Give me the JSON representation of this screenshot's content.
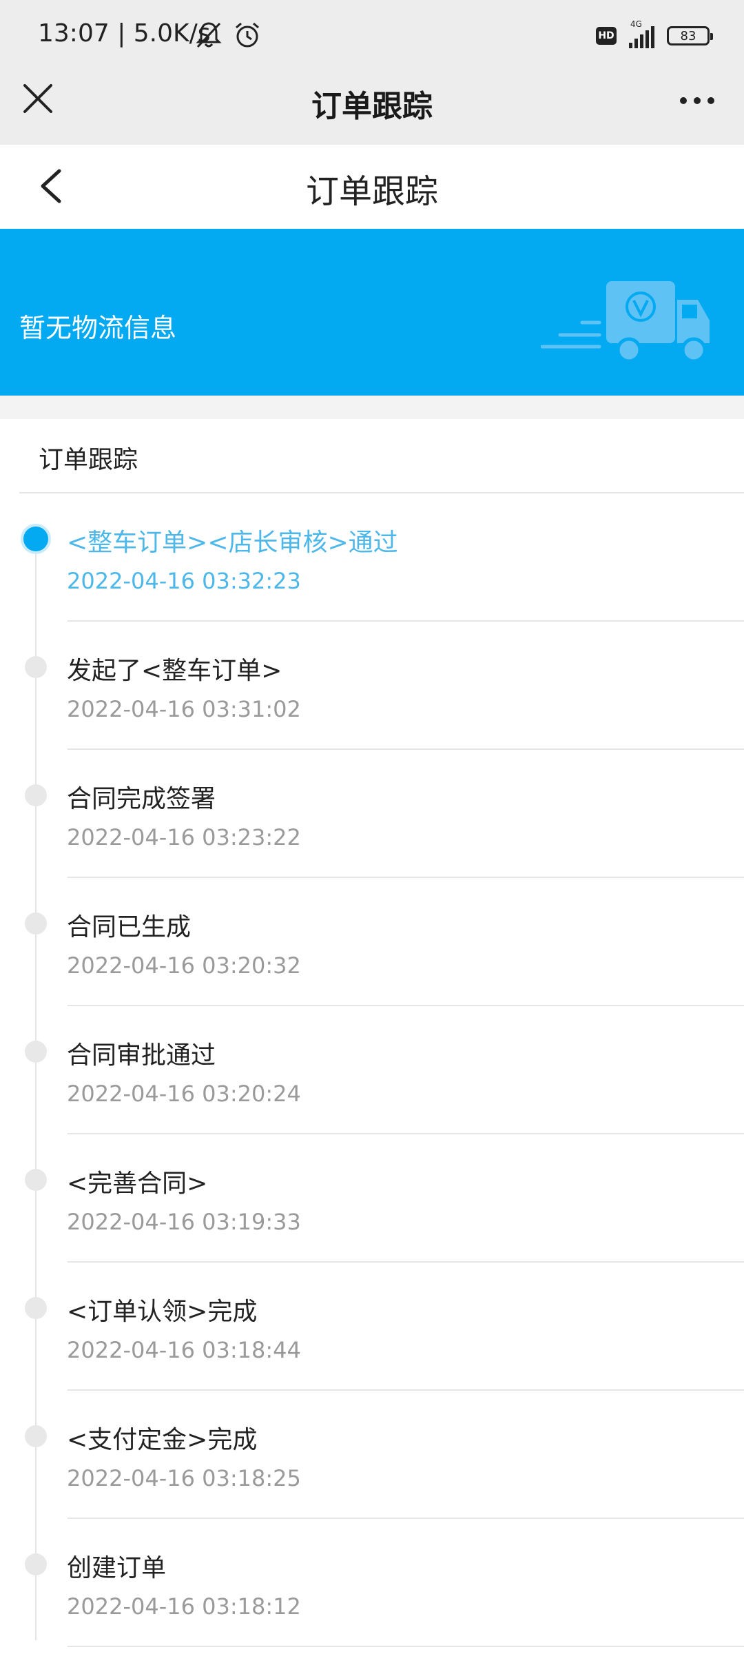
{
  "status_bar": {
    "time": "13:07 | 5.0K/s",
    "hd": "HD",
    "network": "4G",
    "battery": "83"
  },
  "top_header": {
    "title": "订单跟踪"
  },
  "page_header": {
    "title": "订单跟踪"
  },
  "banner": {
    "text": "暂无物流信息",
    "color": "#03a9f1"
  },
  "tracking": {
    "section_title": "订单跟踪",
    "active_color": "#4db7e9",
    "events": [
      {
        "label": "<整车订单><店长审核>通过",
        "time": "2022-04-16 03:32:23"
      },
      {
        "label": "发起了<整车订单>",
        "time": "2022-04-16 03:31:02"
      },
      {
        "label": "合同完成签署",
        "time": "2022-04-16 03:23:22"
      },
      {
        "label": "合同已生成",
        "time": "2022-04-16 03:20:32"
      },
      {
        "label": "合同审批通过",
        "time": "2022-04-16 03:20:24"
      },
      {
        "label": "<完善合同>",
        "time": "2022-04-16 03:19:33"
      },
      {
        "label": "<订单认领>完成",
        "time": "2022-04-16 03:18:44"
      },
      {
        "label": "<支付定金>完成",
        "time": "2022-04-16 03:18:25"
      },
      {
        "label": "创建订单",
        "time": "2022-04-16 03:18:12"
      }
    ]
  }
}
